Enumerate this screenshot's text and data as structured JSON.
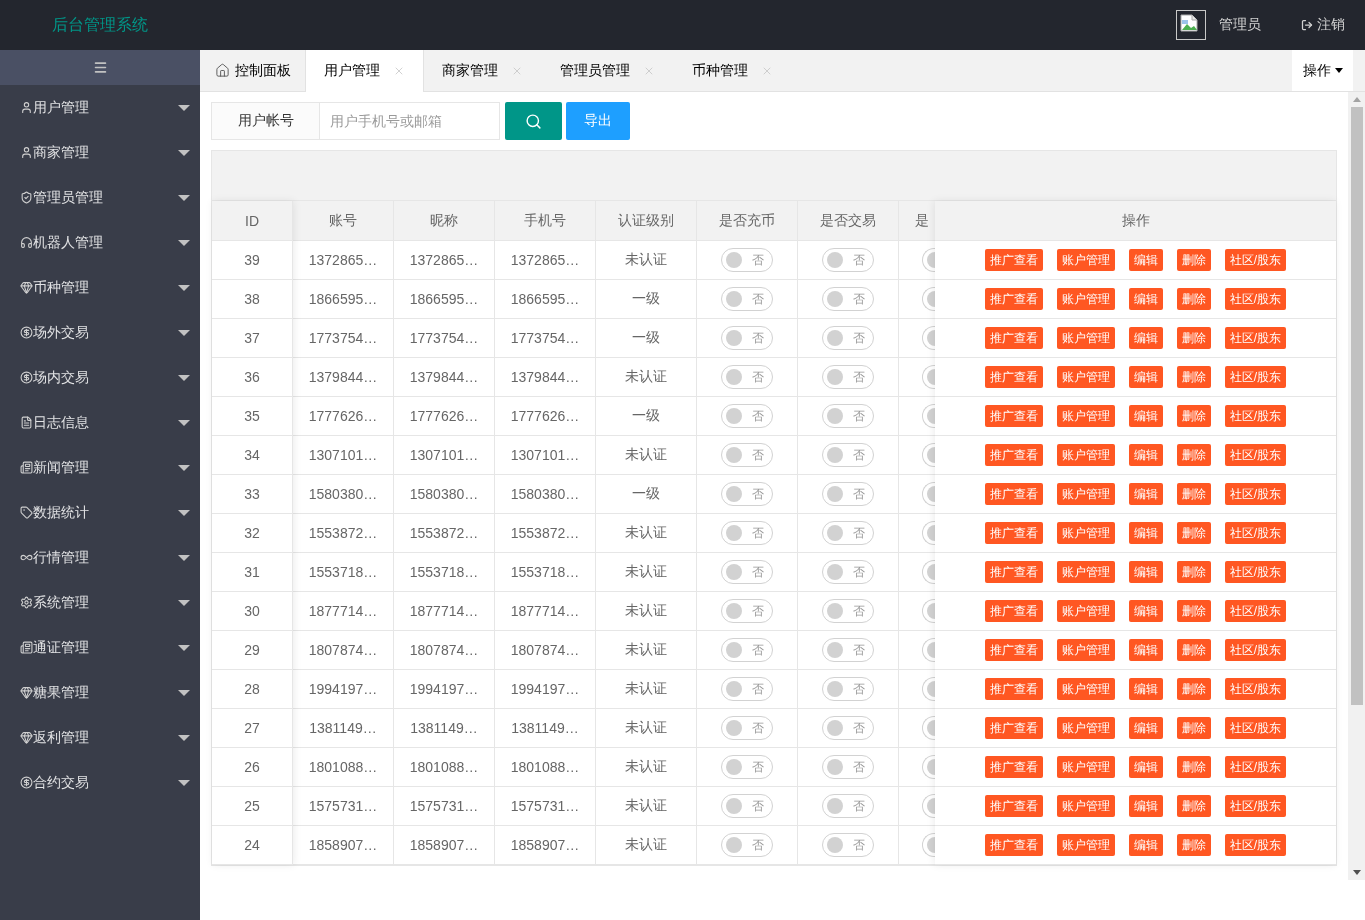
{
  "header": {
    "title": "后台管理系统",
    "user": "管理员",
    "logout": "注销"
  },
  "sidebar": {
    "items": [
      {
        "label": "用户管理",
        "expanded": false
      },
      {
        "label": "商家管理",
        "expanded": false
      },
      {
        "label": "管理员管理",
        "expanded": false
      },
      {
        "label": "机器人管理",
        "expanded": false
      },
      {
        "label": "币种管理",
        "expanded": false
      },
      {
        "label": "场外交易",
        "expanded": false
      },
      {
        "label": "场内交易",
        "expanded": false
      },
      {
        "label": "日志信息",
        "expanded": false
      },
      {
        "label": "新闻管理",
        "expanded": false
      },
      {
        "label": "数据统计",
        "expanded": false
      },
      {
        "label": "行情管理",
        "expanded": false
      },
      {
        "label": "系统管理",
        "expanded": false
      },
      {
        "label": "通证管理",
        "expanded": false
      },
      {
        "label": "糖果管理",
        "expanded": false
      },
      {
        "label": "返利管理",
        "expanded": false
      },
      {
        "label": "合约交易",
        "expanded": false
      }
    ]
  },
  "tabs": [
    {
      "kind": "home",
      "label": "控制面板",
      "selected": false
    },
    {
      "kind": "page",
      "label": "用户管理",
      "selected": true
    },
    {
      "kind": "page",
      "label": "商家管理",
      "selected": false
    },
    {
      "kind": "page",
      "label": "管理员管理",
      "selected": false
    },
    {
      "kind": "page",
      "label": "币种管理",
      "selected": false
    }
  ],
  "tab_menu": {
    "label": "操作"
  },
  "search": {
    "label": "用户帐号",
    "placeholder": "用户手机号或邮箱",
    "export": "导出"
  },
  "table": {
    "columns": [
      "ID",
      "账号",
      "昵称",
      "手机号",
      "认证级别",
      "是否充币",
      "是否交易",
      "是"
    ],
    "action_column": "操作",
    "rows": [
      {
        "id": "39",
        "account": "1372865…",
        "nickname": "1372865…",
        "phone": "1372865…",
        "level": "未认证",
        "switches": [
          {
            "on": false,
            "label": "否"
          },
          {
            "on": false,
            "label": "否"
          },
          {
            "on": false
          }
        ],
        "actions": [
          "推广查看",
          "账户管理",
          "编辑",
          "删除",
          "社区/股东"
        ]
      },
      {
        "id": "38",
        "account": "1866595…",
        "nickname": "1866595…",
        "phone": "1866595…",
        "level": "一级",
        "switches": [
          {
            "on": false,
            "label": "否"
          },
          {
            "on": false,
            "label": "否"
          },
          {
            "on": false
          }
        ],
        "actions": [
          "推广查看",
          "账户管理",
          "编辑",
          "删除",
          "社区/股东"
        ]
      },
      {
        "id": "37",
        "account": "1773754…",
        "nickname": "1773754…",
        "phone": "1773754…",
        "level": "一级",
        "switches": [
          {
            "on": false,
            "label": "否"
          },
          {
            "on": false,
            "label": "否"
          },
          {
            "on": false
          }
        ],
        "actions": [
          "推广查看",
          "账户管理",
          "编辑",
          "删除",
          "社区/股东"
        ]
      },
      {
        "id": "36",
        "account": "1379844…",
        "nickname": "1379844…",
        "phone": "1379844…",
        "level": "未认证",
        "switches": [
          {
            "on": false,
            "label": "否"
          },
          {
            "on": false,
            "label": "否"
          },
          {
            "on": false
          }
        ],
        "actions": [
          "推广查看",
          "账户管理",
          "编辑",
          "删除",
          "社区/股东"
        ]
      },
      {
        "id": "35",
        "account": "1777626…",
        "nickname": "1777626…",
        "phone": "1777626…",
        "level": "一级",
        "switches": [
          {
            "on": false,
            "label": "否"
          },
          {
            "on": false,
            "label": "否"
          },
          {
            "on": false
          }
        ],
        "actions": [
          "推广查看",
          "账户管理",
          "编辑",
          "删除",
          "社区/股东"
        ]
      },
      {
        "id": "34",
        "account": "1307101…",
        "nickname": "1307101…",
        "phone": "1307101…",
        "level": "未认证",
        "switches": [
          {
            "on": false,
            "label": "否"
          },
          {
            "on": false,
            "label": "否"
          },
          {
            "on": false
          }
        ],
        "actions": [
          "推广查看",
          "账户管理",
          "编辑",
          "删除",
          "社区/股东"
        ]
      },
      {
        "id": "33",
        "account": "1580380…",
        "nickname": "1580380…",
        "phone": "1580380…",
        "level": "一级",
        "switches": [
          {
            "on": false,
            "label": "否"
          },
          {
            "on": false,
            "label": "否"
          },
          {
            "on": false
          }
        ],
        "actions": [
          "推广查看",
          "账户管理",
          "编辑",
          "删除",
          "社区/股东"
        ]
      },
      {
        "id": "32",
        "account": "1553872…",
        "nickname": "1553872…",
        "phone": "1553872…",
        "level": "未认证",
        "switches": [
          {
            "on": false,
            "label": "否"
          },
          {
            "on": false,
            "label": "否"
          },
          {
            "on": false
          }
        ],
        "actions": [
          "推广查看",
          "账户管理",
          "编辑",
          "删除",
          "社区/股东"
        ]
      },
      {
        "id": "31",
        "account": "1553718…",
        "nickname": "1553718…",
        "phone": "1553718…",
        "level": "未认证",
        "switches": [
          {
            "on": false,
            "label": "否"
          },
          {
            "on": false,
            "label": "否"
          },
          {
            "on": false
          }
        ],
        "actions": [
          "推广查看",
          "账户管理",
          "编辑",
          "删除",
          "社区/股东"
        ]
      },
      {
        "id": "30",
        "account": "1877714…",
        "nickname": "1877714…",
        "phone": "1877714…",
        "level": "未认证",
        "switches": [
          {
            "on": false,
            "label": "否"
          },
          {
            "on": false,
            "label": "否"
          },
          {
            "on": false
          }
        ],
        "actions": [
          "推广查看",
          "账户管理",
          "编辑",
          "删除",
          "社区/股东"
        ]
      },
      {
        "id": "29",
        "account": "1807874…",
        "nickname": "1807874…",
        "phone": "1807874…",
        "level": "未认证",
        "switches": [
          {
            "on": false,
            "label": "否"
          },
          {
            "on": false,
            "label": "否"
          },
          {
            "on": false
          }
        ],
        "actions": [
          "推广查看",
          "账户管理",
          "编辑",
          "删除",
          "社区/股东"
        ]
      },
      {
        "id": "28",
        "account": "1994197…",
        "nickname": "1994197…",
        "phone": "1994197…",
        "level": "未认证",
        "switches": [
          {
            "on": false,
            "label": "否"
          },
          {
            "on": false,
            "label": "否"
          },
          {
            "on": false
          }
        ],
        "actions": [
          "推广查看",
          "账户管理",
          "编辑",
          "删除",
          "社区/股东"
        ]
      },
      {
        "id": "27",
        "account": "1381149…",
        "nickname": "1381149…",
        "phone": "1381149…",
        "level": "未认证",
        "switches": [
          {
            "on": false,
            "label": "否"
          },
          {
            "on": false,
            "label": "否"
          },
          {
            "on": false
          }
        ],
        "actions": [
          "推广查看",
          "账户管理",
          "编辑",
          "删除",
          "社区/股东"
        ]
      },
      {
        "id": "26",
        "account": "1801088…",
        "nickname": "1801088…",
        "phone": "1801088…",
        "level": "未认证",
        "switches": [
          {
            "on": false,
            "label": "否"
          },
          {
            "on": false,
            "label": "否"
          },
          {
            "on": false
          }
        ],
        "actions": [
          "推广查看",
          "账户管理",
          "编辑",
          "删除",
          "社区/股东"
        ]
      },
      {
        "id": "25",
        "account": "1575731…",
        "nickname": "1575731…",
        "phone": "1575731…",
        "level": "未认证",
        "switches": [
          {
            "on": false,
            "label": "否"
          },
          {
            "on": false,
            "label": "否"
          },
          {
            "on": false
          }
        ],
        "actions": [
          "推广查看",
          "账户管理",
          "编辑",
          "删除",
          "社区/股东"
        ]
      },
      {
        "id": "24",
        "account": "1858907…",
        "nickname": "1858907…",
        "phone": "1858907…",
        "level": "未认证",
        "switches": [
          {
            "on": false,
            "label": "否"
          },
          {
            "on": false,
            "label": "否"
          },
          {
            "on": false
          }
        ],
        "actions": [
          "推广查看",
          "账户管理",
          "编辑",
          "删除",
          "社区/股东"
        ]
      }
    ]
  }
}
